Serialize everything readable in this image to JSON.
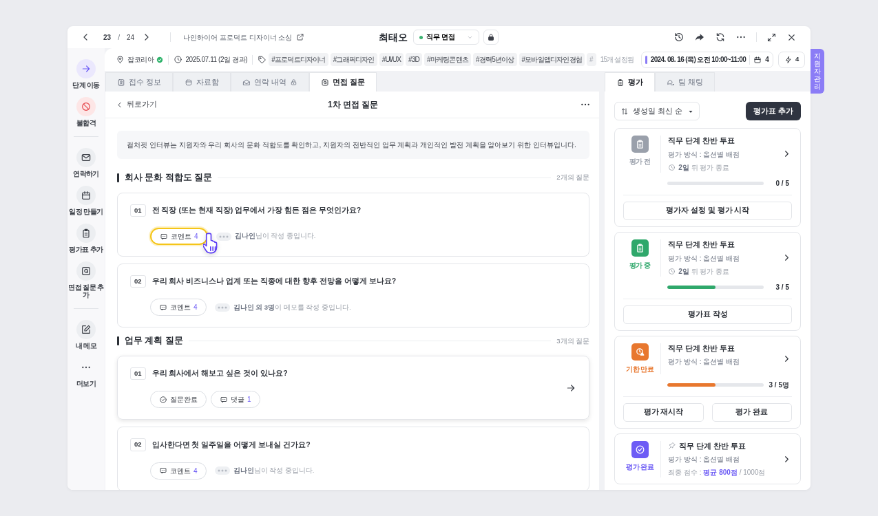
{
  "topbar": {
    "page_current": "23",
    "page_separator": "/",
    "page_total": "24",
    "posting_title": "나인하이어 프로덕트 디자이너 소싱",
    "candidate_name": "최태오",
    "stage": "직무 면접"
  },
  "side_tab": "지원자 관리",
  "sidebar": {
    "groups": [
      [
        {
          "kind": "move",
          "label": "단계 이동"
        },
        {
          "kind": "reject",
          "label": "불합격"
        }
      ],
      [
        {
          "kind": "contact",
          "label": "연락하기"
        },
        {
          "kind": "schedule",
          "label": "일정 만들기"
        },
        {
          "kind": "evaluation",
          "label": "평가표 추가"
        },
        {
          "kind": "question",
          "label": "면접 질문 추가"
        }
      ],
      [
        {
          "kind": "memo",
          "label": "내 메모"
        },
        {
          "kind": "more",
          "label": "더보기"
        }
      ]
    ]
  },
  "info_bar": {
    "source": "잡코리아",
    "verified": true,
    "applied": "2025.07.11 (2일 경과)",
    "tags": [
      "#프로덕트디자이너",
      "#그래픽디자인",
      "#UI/UX",
      "#3D",
      "#마케팅콘텐츠",
      "#경력5년이상",
      "#모바일앱디자인경험"
    ],
    "tag_overflow": "#",
    "tag_total": "15개 설정됨",
    "schedule": "2024. 08. 16 (목) 오전 10:00~11:00",
    "schedule_count": "4",
    "bolt_count": "4"
  },
  "tabs": [
    {
      "kind": "info",
      "label": "접수 정보",
      "locked": false,
      "selected": false
    },
    {
      "kind": "files",
      "label": "자료함",
      "locked": false,
      "selected": false
    },
    {
      "kind": "contact",
      "label": "연락 내역",
      "locked": true,
      "selected": false
    },
    {
      "kind": "question",
      "label": "면접 질문",
      "locked": false,
      "selected": true
    }
  ],
  "questions": {
    "back": "뒤로가기",
    "title": "1차 면접 질문",
    "description": "컬처핏 인터뷰는 지원자와 우리 회사의 문화 적합도를 확인하고, 지원자의 전반적인 업무 계획과 개인적인 발전 계획을 알아보기 위한 인터뷰입니다.",
    "sections": [
      {
        "title": "회사 문화 적합도 질문",
        "count": "2개의 질문",
        "items": [
          {
            "number": "01",
            "text": "전 직장 (또는 현재 직장) 업무에서 가장 힘든 점은 무엇인가요?",
            "selected": false,
            "chips": [
              {
                "kind": "comment",
                "label": "코멘트",
                "count": "4",
                "highlighted": true
              }
            ],
            "typing": "**김나인**님이 작성 중입니다."
          },
          {
            "number": "02",
            "text": "우리 회사 비즈니스나 업계 또는 직종에 대한 향후 전망을 어떻게 보나요?",
            "selected": false,
            "chips": [
              {
                "kind": "comment",
                "label": "코멘트",
                "count": "4",
                "highlighted": false
              }
            ],
            "typing": "**김나인 외 3명**이 메모를 작성 중입니다."
          }
        ]
      },
      {
        "title": "업무 계획 질문",
        "count": "3개의 질문",
        "items": [
          {
            "number": "01",
            "text": "우리 회사에서 해보고 싶은 것이 있나요?",
            "selected": true,
            "chips": [
              {
                "kind": "done",
                "label": "질문완료",
                "highlighted": false
              },
              {
                "kind": "comment",
                "label": "댓글",
                "count": "1",
                "highlighted": false
              }
            ]
          },
          {
            "number": "02",
            "text": "입사한다면 첫 일주일을 어떻게 보내실 건가요?",
            "selected": false,
            "chips": [
              {
                "kind": "comment",
                "label": "코멘트",
                "count": "4",
                "highlighted": false
              }
            ],
            "typing": "**김나인**님이 작성 중입니다."
          }
        ]
      }
    ]
  },
  "panel_tabs": [
    {
      "kind": "evaluation",
      "label": "평가",
      "selected": true
    },
    {
      "kind": "chat",
      "label": "팀 채팅",
      "selected": false
    }
  ],
  "evaluation": {
    "sort": "생성일 최신 순",
    "add_button": "평가표 추가",
    "cards": [
      {
        "kind": "pending",
        "status": "평가 전",
        "color": "#9aa0ab",
        "pinned": false,
        "title": "직무 단계 찬반 투표",
        "method": "평가 방식 : 옵션별 배점",
        "deadline": "**2일** 뒤 평가 종료",
        "level": 0,
        "progress": "0 / 5",
        "actions": [
          "평가자 설정 및 평가 시작"
        ]
      },
      {
        "kind": "active",
        "status": "평가 중",
        "color": "#2fa86b",
        "pinned": false,
        "title": "직무 단계 찬반 투표",
        "method": "평가 방식 : 옵션별 배점",
        "deadline": "**2일** 뒤 평가 종료",
        "level": 0.5,
        "progress": "3 / 5",
        "actions": [
          "평가표 작성"
        ]
      },
      {
        "kind": "expired",
        "status": "기한 만료",
        "color": "#e8772e",
        "pinned": false,
        "title": "직무 단계 찬반 투표",
        "method": "평가 방식 : 옵션별 배점",
        "level": 0.5,
        "progress": "3 / 5명",
        "actions": [
          "평가 재시작",
          "평가 완료"
        ]
      },
      {
        "kind": "done",
        "status": "평가 완료",
        "color": "#6d5cf5",
        "pinned": true,
        "title": "직무 단계 찬반 투표",
        "method": "평가 방식 : 옵션별 배점",
        "score": "최종 점수 : **평균 800점** / 1000점"
      }
    ]
  }
}
